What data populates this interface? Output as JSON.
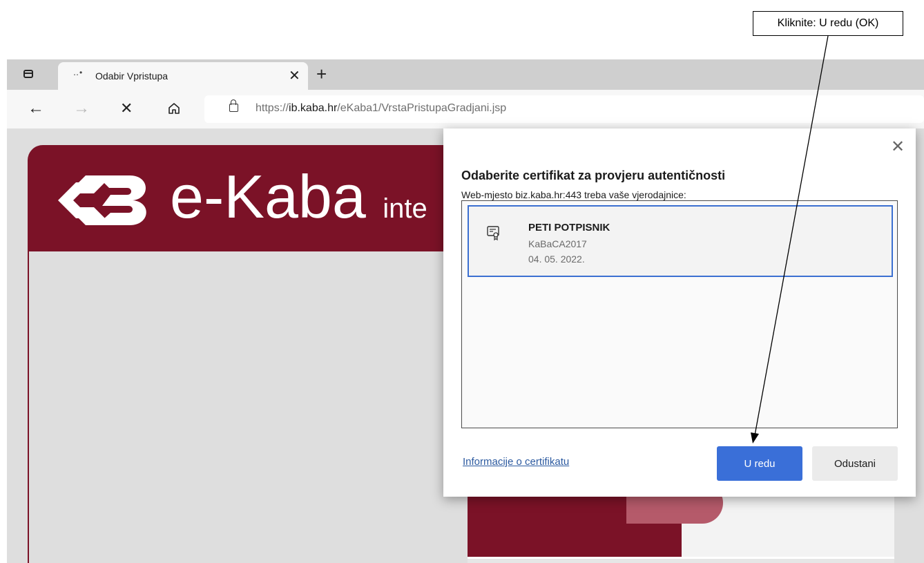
{
  "callout": {
    "text": "Kliknite: U redu (OK)"
  },
  "browser": {
    "tab": {
      "title": "Odabir Vpristupa",
      "favicon": "‥•"
    },
    "toolbar": {
      "url_prefix": "https://",
      "url_host": "ib.kaba.hr",
      "url_path": "/eKaba1/VrstaPristupaGradjani.jsp"
    }
  },
  "site": {
    "logo_text": "e-Kaba",
    "logo_sub": "inte"
  },
  "dialog": {
    "title": "Odaberite certifikat za provjeru autentičnosti",
    "subtitle": "Web-mjesto biz.kaba.hr:443 treba vaše vjerodajnice:",
    "certificates": [
      {
        "name": "PETI POTPISNIK",
        "issuer": "KaBaCA2017",
        "date": "04. 05. 2022."
      }
    ],
    "info_link": "Informacije o certifikatu",
    "ok_label": "U redu",
    "cancel_label": "Odustani"
  },
  "colors": {
    "brand": "#7b1227",
    "primary_button": "#3a6fd8",
    "selection_border": "#3b6fd1"
  }
}
